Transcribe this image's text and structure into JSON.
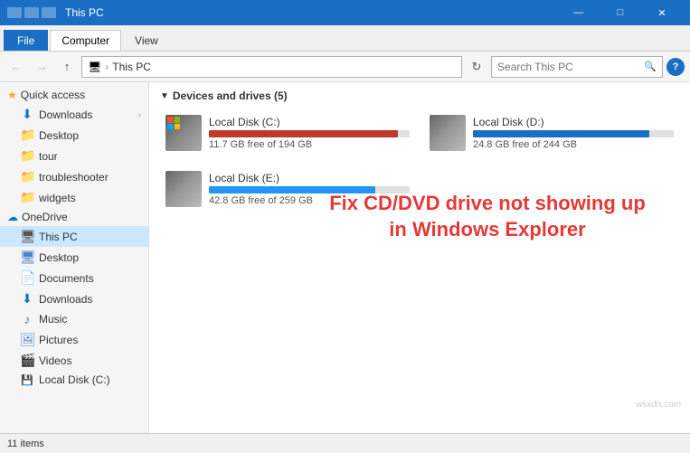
{
  "titlebar": {
    "title": "This PC",
    "controls": {
      "minimize": "—",
      "maximize": "□",
      "close": "✕"
    }
  },
  "ribbon": {
    "tabs": [
      "File",
      "Computer",
      "View"
    ],
    "active_tab": "Computer"
  },
  "addressbar": {
    "path_icon": "🖥",
    "path_label": "This PC",
    "search_placeholder": "Search This PC",
    "help": "?"
  },
  "sidebar": {
    "quick_access_label": "Quick access",
    "items_quick": [
      {
        "label": "Downloads",
        "type": "download"
      },
      {
        "label": "Desktop",
        "type": "folder"
      },
      {
        "label": "tour",
        "type": "folder"
      },
      {
        "label": "troubleshooter",
        "type": "folder"
      },
      {
        "label": "widgets",
        "type": "folder"
      }
    ],
    "onedrive_label": "OneDrive",
    "thispc_label": "This PC",
    "items_thispc": [
      {
        "label": "Desktop",
        "type": "desktop"
      },
      {
        "label": "Documents",
        "type": "docs"
      },
      {
        "label": "Downloads",
        "type": "download"
      },
      {
        "label": "Music",
        "type": "music"
      },
      {
        "label": "Pictures",
        "type": "pics"
      },
      {
        "label": "Videos",
        "type": "videos"
      },
      {
        "label": "Local Disk (C:)",
        "type": "drive"
      }
    ]
  },
  "content": {
    "section_title": "Devices and drives (5)",
    "drives": [
      {
        "name": "Local Disk (C:)",
        "free": "11.7 GB free of 194 GB",
        "bar_class": "drive-bar-c",
        "thumb_class": "drive-thumb-c",
        "show_windows": true
      },
      {
        "name": "Local Disk (D:)",
        "free": "24.8 GB free of 244 GB",
        "bar_class": "drive-bar-d",
        "thumb_class": "drive-thumb-d",
        "show_windows": false
      },
      {
        "name": "Local Disk (E:)",
        "free": "42.8 GB free of 259 GB",
        "bar_class": "drive-bar-e",
        "thumb_class": "drive-thumb-e",
        "show_windows": false
      }
    ],
    "overlay_line1": "Fix CD/DVD drive not showing up",
    "overlay_line2": "in Windows Explorer"
  },
  "statusbar": {
    "item_count": "11 items"
  }
}
